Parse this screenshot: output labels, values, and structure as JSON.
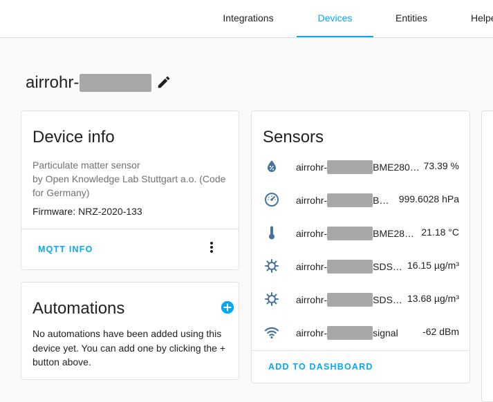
{
  "tabs": [
    {
      "label": "Integrations"
    },
    {
      "label": "Devices"
    },
    {
      "label": "Entities"
    },
    {
      "label": "Helpe"
    }
  ],
  "device": {
    "name_prefix": "airrohr-"
  },
  "device_info": {
    "title": "Device info",
    "line1": "Particulate matter sensor",
    "line2": "by Open Knowledge Lab Stuttgart a.o. (Code",
    "line3": "for Germany)",
    "firmware": "Firmware: NRZ-2020-133",
    "mqtt_label": "MQTT INFO"
  },
  "automations": {
    "title": "Automations",
    "line1": "No automations have been added using this",
    "line2": "device yet. You can add one by clicking the +",
    "line3": "button above."
  },
  "sensors": {
    "title": "Sensors",
    "items": [
      {
        "prefix": "airrohr-",
        "suffix": "BME280…",
        "value": "73.39 %",
        "icon": "water-percent-icon"
      },
      {
        "prefix": "airrohr-",
        "suffix": "B…",
        "value": "999.6028 hPa",
        "icon": "gauge-icon"
      },
      {
        "prefix": "airrohr-",
        "suffix": "BME28…",
        "value": "21.18 °C",
        "icon": "thermometer-icon"
      },
      {
        "prefix": "airrohr-",
        "suffix": "SDS…",
        "value": "16.15 µg/m³",
        "icon": "virus-icon"
      },
      {
        "prefix": "airrohr-",
        "suffix": "SDS…",
        "value": "13.68 µg/m³",
        "icon": "virus-icon"
      },
      {
        "prefix": "airrohr-",
        "suffix": "signal",
        "value": "-62 dBm",
        "icon": "wifi-icon"
      }
    ],
    "add_label": "ADD TO DASHBOARD"
  },
  "colors": {
    "accent": "#03a9f4",
    "icon": "#44739e"
  }
}
